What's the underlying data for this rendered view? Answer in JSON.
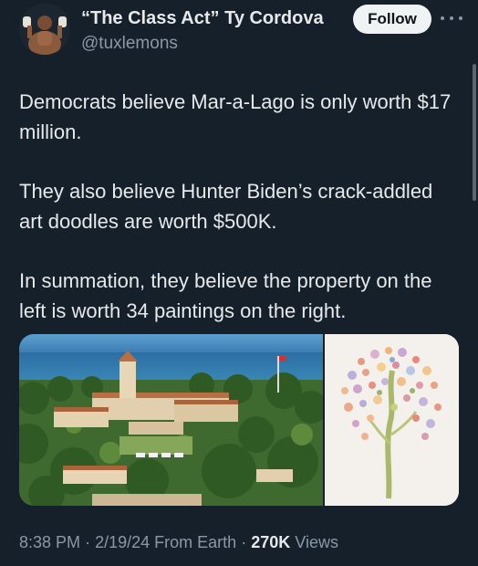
{
  "author": {
    "display_name": "“The Class Act” Ty Cordova",
    "handle": "@tuxlemons",
    "avatar_icon": "boxer-avatar"
  },
  "actions": {
    "follow_label": "Follow",
    "more_icon": "more-horizontal-icon"
  },
  "tweet": {
    "paragraphs": [
      "Democrats believe Mar-a-Lago is only worth $17 million.",
      "They also believe Hunter Biden’s crack-addled art doodles are worth $500K.",
      "In summation, they believe the property on the left is worth 34 paintings on the right."
    ]
  },
  "media": {
    "left_image": "estate-aerial-photo",
    "right_image": "abstract-dot-painting"
  },
  "meta": {
    "time": "8:38 PM",
    "date": "2/19/24",
    "source": "From Earth",
    "separator": "·",
    "views_count": "270K",
    "views_label": "Views"
  },
  "colors": {
    "background": "#15202b",
    "text_primary": "#e7e9ea",
    "text_secondary": "#8b98a5",
    "follow_bg": "#eff3f4"
  }
}
